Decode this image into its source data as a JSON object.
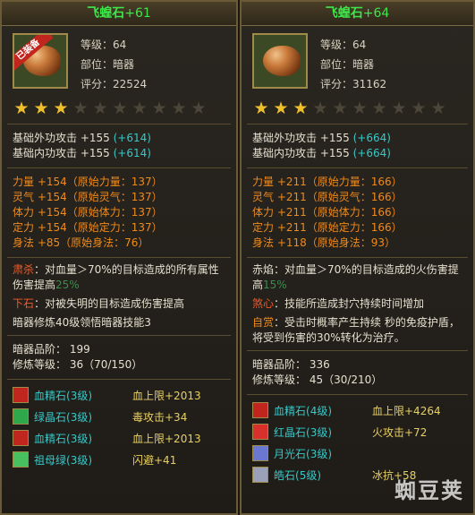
{
  "left": {
    "name": "飞蝗石",
    "plus": "+61",
    "badge": "已装备",
    "level_label": "等级：64",
    "slot_label": "部位：暗器",
    "score_label": "评分：22524",
    "stars_on": 3,
    "stars_total": 10,
    "base": [
      {
        "text": "基础外功攻击 +155",
        "extra": "(+614)"
      },
      {
        "text": "基础内功攻击 +155",
        "extra": "(+614)"
      }
    ],
    "attrs": [
      "力量 +154（原始力量：137）",
      "灵气 +154（原始灵气：137）",
      "体力 +154（原始体力：137）",
      "定力 +154（原始定力：137）",
      "身法 +85（原始身法：76）"
    ],
    "skill1_name": "肃杀",
    "skill1_text": "：对血量＞70%的目标造成的所有属性伤害提高",
    "skill1_pct": "25%",
    "skill2_name": "下石",
    "skill2_text": "：对被失明的目标造成伤害提高",
    "skill3_text": "暗器修炼40级领悟暗器技能3",
    "grade": "暗器品阶：  199",
    "train": "修炼等级：  36（70/150）",
    "gems": [
      {
        "name": "血精石",
        "lvl": "(3级)",
        "stat": "血上限+2013",
        "icon": "blood-stone-icon",
        "color": "#c0261e"
      },
      {
        "name": "绿晶石",
        "lvl": "(3级)",
        "stat": "毒攻击+34",
        "icon": "green-crystal-icon",
        "color": "#2ea84a"
      },
      {
        "name": "血精石",
        "lvl": "(3级)",
        "stat": "血上限+2013",
        "icon": "blood-stone-icon",
        "color": "#c0261e"
      },
      {
        "name": "祖母绿",
        "lvl": "(3级)",
        "stat": "闪避+41",
        "icon": "emerald-icon",
        "color": "#48c060"
      }
    ]
  },
  "right": {
    "name": "飞蝗石",
    "plus": "+64",
    "level_label": "等级：64",
    "slot_label": "部位：暗器",
    "score_label": "评分：31162",
    "stars_on": 3,
    "stars_total": 10,
    "base": [
      {
        "text": "基础外功攻击 +155",
        "extra": "(+664)"
      },
      {
        "text": "基础内功攻击 +155",
        "extra": "(+664)"
      }
    ],
    "attrs": [
      "力量 +211（原始力量：166）",
      "灵气 +211（原始灵气：166）",
      "体力 +211（原始体力：166）",
      "定力 +211（原始定力：166）",
      "身法 +118（原始身法：93）"
    ],
    "skill1_name": "赤焰",
    "skill1_text": "：对血量＞70%的目标造成的火伤害提高",
    "skill1_pct": "15%",
    "skill2_name": "煞心",
    "skill2_text": "：技能所造成封穴持续时间增加",
    "skill3_name": "自赏",
    "skill3_text": "：受击时概率产生持续 秒的免疫护盾，将受到伤害的30%转化为治疗。",
    "grade": "暗器品阶：  336",
    "train": "修炼等级：  45（30/210）",
    "gems": [
      {
        "name": "血精石",
        "lvl": "(4级)",
        "stat": "血上限+4264",
        "icon": "blood-stone-icon",
        "color": "#c0261e"
      },
      {
        "name": "红晶石",
        "lvl": "(3级)",
        "stat": "火攻击+72",
        "icon": "red-crystal-icon",
        "color": "#d8302a"
      },
      {
        "name": "月光石",
        "lvl": "(3级)",
        "stat": "",
        "icon": "moonstone-icon",
        "color": "#6a78d0"
      },
      {
        "name": "皓石",
        "lvl": "(5级)",
        "stat": "冰抗+58",
        "icon": "white-stone-icon",
        "color": "#9aa0b8"
      }
    ]
  },
  "watermark": "蜘豆荚"
}
